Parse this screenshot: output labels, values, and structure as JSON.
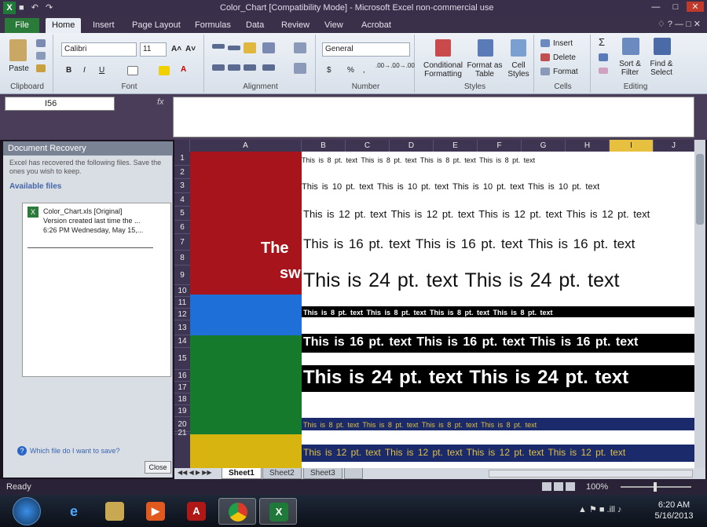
{
  "window": {
    "title": "Color_Chart  [Compatibility Mode] - Microsoft Excel non-commercial use",
    "app_icon": "X",
    "qat": [
      "■",
      "↶",
      "↷"
    ],
    "controls": [
      "—",
      "□",
      "✕"
    ]
  },
  "tabs": [
    {
      "label": "File"
    },
    {
      "label": "Home"
    },
    {
      "label": "Insert"
    },
    {
      "label": "Page Layout"
    },
    {
      "label": "Formulas"
    },
    {
      "label": "Data"
    },
    {
      "label": "Review"
    },
    {
      "label": "View"
    },
    {
      "label": "Acrobat"
    }
  ],
  "tabs_right": "♢ ? — □ ✕",
  "ribbon": {
    "clipboard": {
      "label": "Clipboard",
      "paste": "Paste"
    },
    "font": {
      "label": "Font",
      "name": "Calibri",
      "size": "11",
      "bold": "B",
      "italic": "I",
      "underline": "U",
      "grow": "A˄",
      "shrink": "A˅",
      "color": "A"
    },
    "alignment": {
      "label": "Alignment"
    },
    "number": {
      "label": "Number",
      "format": "General",
      "currency": "$",
      "percent": "%",
      "comma": ",",
      "inc": ".00→.0",
      "dec": ".0→.00"
    },
    "styles": {
      "label": "Styles",
      "conditional": "Conditional Formatting",
      "table": "Format as Table",
      "cell": "Cell Styles"
    },
    "cells": {
      "label": "Cells",
      "insert": "Insert",
      "delete": "Delete",
      "format": "Format"
    },
    "editing": {
      "label": "Editing",
      "sum": "Σ",
      "sort": "Sort & Filter",
      "find": "Find & Select"
    }
  },
  "formula_bar": {
    "name_box": "I56",
    "fx": "fx",
    "value": ""
  },
  "recovery": {
    "title": "Document Recovery",
    "message": "Excel has recovered the following files.  Save the ones you wish to keep.",
    "available": "Available files",
    "file_name": "Color_Chart.xls  [Original]",
    "file_line2": "Version created last time the ...",
    "file_line3": "6:26 PM Wednesday, May 15,...",
    "help": "Which file do I want to save?",
    "close": "Close"
  },
  "columns": [
    "A",
    "B",
    "C",
    "D",
    "E",
    "F",
    "G",
    "H",
    "I",
    "J"
  ],
  "selected_column": "I",
  "rows": [
    "1",
    "2",
    "3",
    "4",
    "5",
    "6",
    "7",
    "8",
    "9",
    "10",
    "11",
    "12",
    "13",
    "14",
    "15",
    "16",
    "17",
    "18",
    "19",
    "20",
    "21"
  ],
  "overlay_text": {
    "line1": "The",
    "line2": "sw"
  },
  "colors": {
    "red": "#a8141c",
    "blue": "#1f6fd8",
    "green": "#167a2c",
    "yellow": "#d8b410",
    "black": "#000000",
    "navy": "#1a2a6a",
    "gold_text": "#e0c040"
  },
  "text_rows": {
    "pt8": "This is 8 pt. text   This is 8 pt. text   This is 8 pt. text   This is 8 pt. text",
    "pt10": "This is 10 pt. text   This is 10 pt. text   This is 10 pt. text   This is 10 pt. text",
    "pt12": "This is 12 pt. text   This is 12 pt. text   This is 12 pt. text   This is 12 pt. text",
    "pt16": "This is 16 pt. text   This is 16 pt. text   This is 16 pt. text",
    "pt24": "This is 24 pt. text   This is 24 pt. text"
  },
  "sheets": [
    {
      "label": "Sheet1",
      "active": true
    },
    {
      "label": "Sheet2",
      "active": false
    },
    {
      "label": "Sheet3",
      "active": false
    }
  ],
  "status": {
    "ready": "Ready",
    "zoom": "100%"
  },
  "taskbar": {
    "apps": [
      "ie",
      "explorer",
      "media",
      "acrobat",
      "chrome",
      "excel"
    ],
    "time": "6:20 AM",
    "date": "5/16/2013"
  }
}
